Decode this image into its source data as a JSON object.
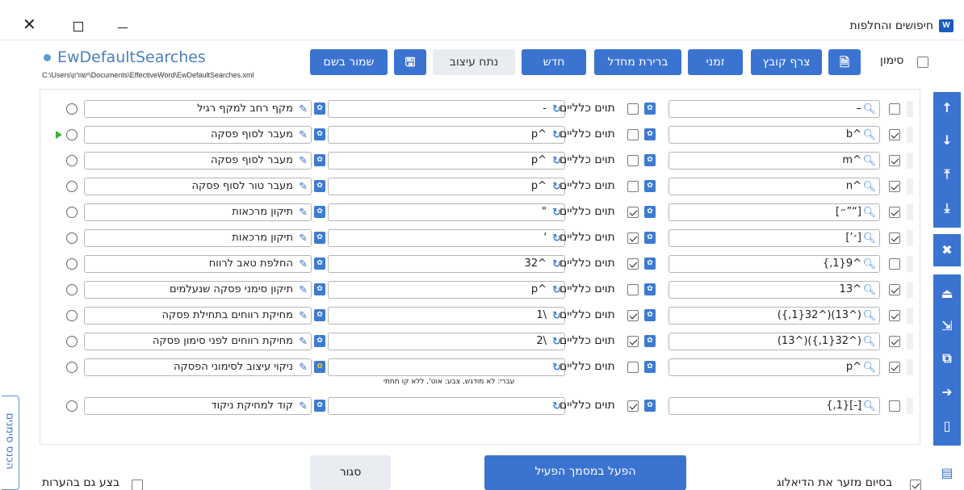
{
  "window": {
    "title": "חיפושים והחלפות",
    "word_icon": "W"
  },
  "doc": {
    "name": "EwDefaultSearches",
    "path": "C:\\Users\\ישורון\\Documents\\EffectiveWord\\EwDefaultSearches.xml"
  },
  "toolbar": {
    "rename_label": "שמור בשם",
    "save_icon": "save-icon",
    "analyze_label": "נתח עיצוב",
    "new_label": "חדש",
    "default_label": "ברירת מחדל",
    "temp_label": "זמני",
    "attach_label": "צרף קובץ",
    "file_icon": "file-icon",
    "mark_label": "סימון"
  },
  "rows": [
    {
      "desc": "מקף רחב למקף רגיל",
      "repl": "-",
      "ww": false,
      "find": "–",
      "use": false,
      "active": false
    },
    {
      "desc": "מעבר לסוף פסקה",
      "repl": "^p",
      "ww": false,
      "find": "^b",
      "use": true,
      "active": true
    },
    {
      "desc": "מעבר לסוף פסקה",
      "repl": "^p",
      "ww": false,
      "find": "^m",
      "use": true,
      "active": false
    },
    {
      "desc": "מעבר טור לסוף פסקה",
      "repl": "^p",
      "ww": false,
      "find": "^n",
      "use": true,
      "active": false
    },
    {
      "desc": "תיקון מרכאות",
      "repl": "\"",
      "ww": true,
      "find": "[“”״]",
      "use": true,
      "active": false
    },
    {
      "desc": "תיקון מרכאות",
      "repl": "'",
      "ww": true,
      "find": "[׳’]",
      "use": true,
      "active": false
    },
    {
      "desc": "החלפת טאב לרווח",
      "repl": "^32",
      "ww": true,
      "find": "^9{1,}",
      "use": false,
      "active": false
    },
    {
      "desc": "תיקון סימני פסקה שנעלמים",
      "repl": "^p",
      "ww": false,
      "find": "^13",
      "use": true,
      "active": false
    },
    {
      "desc": "מחיקת רווחים בתחילת פסקה",
      "repl": "\\1",
      "ww": true,
      "find": "(^13)(^32{1,})",
      "use": true,
      "active": false
    },
    {
      "desc": "מחיקת רווחים לפני סימון פסקה",
      "repl": "\\2",
      "ww": true,
      "find": "(^32{1,})(^13)",
      "use": true,
      "active": false
    },
    {
      "desc": "ניקוי עיצוב לסימוני הפסקה",
      "repl": "",
      "ww": false,
      "find": "^p",
      "use": true,
      "active": false,
      "note": "עברי: לא מודגש, צבע: אוט', ללא קו תחתי"
    },
    {
      "desc": "קוד למחיקת ניקוד",
      "repl": "",
      "ww": true,
      "find": "[ְ-ּׁׂ]{1,}",
      "use": false,
      "active": false
    }
  ],
  "whole_words_label": "תוים כלליים",
  "side_tab_label": "הכנס סימנים",
  "bottom": {
    "run_label": "הפעל במסמך הפעיל",
    "close_label": "סגור",
    "minimize_label": "בסיום מזער את הדיאלוג",
    "comments_label": "בצע גם בהערות"
  },
  "colors": {
    "accent": "#3b73d1",
    "link": "#4a7ebf",
    "active_marker": "#3db33d"
  }
}
